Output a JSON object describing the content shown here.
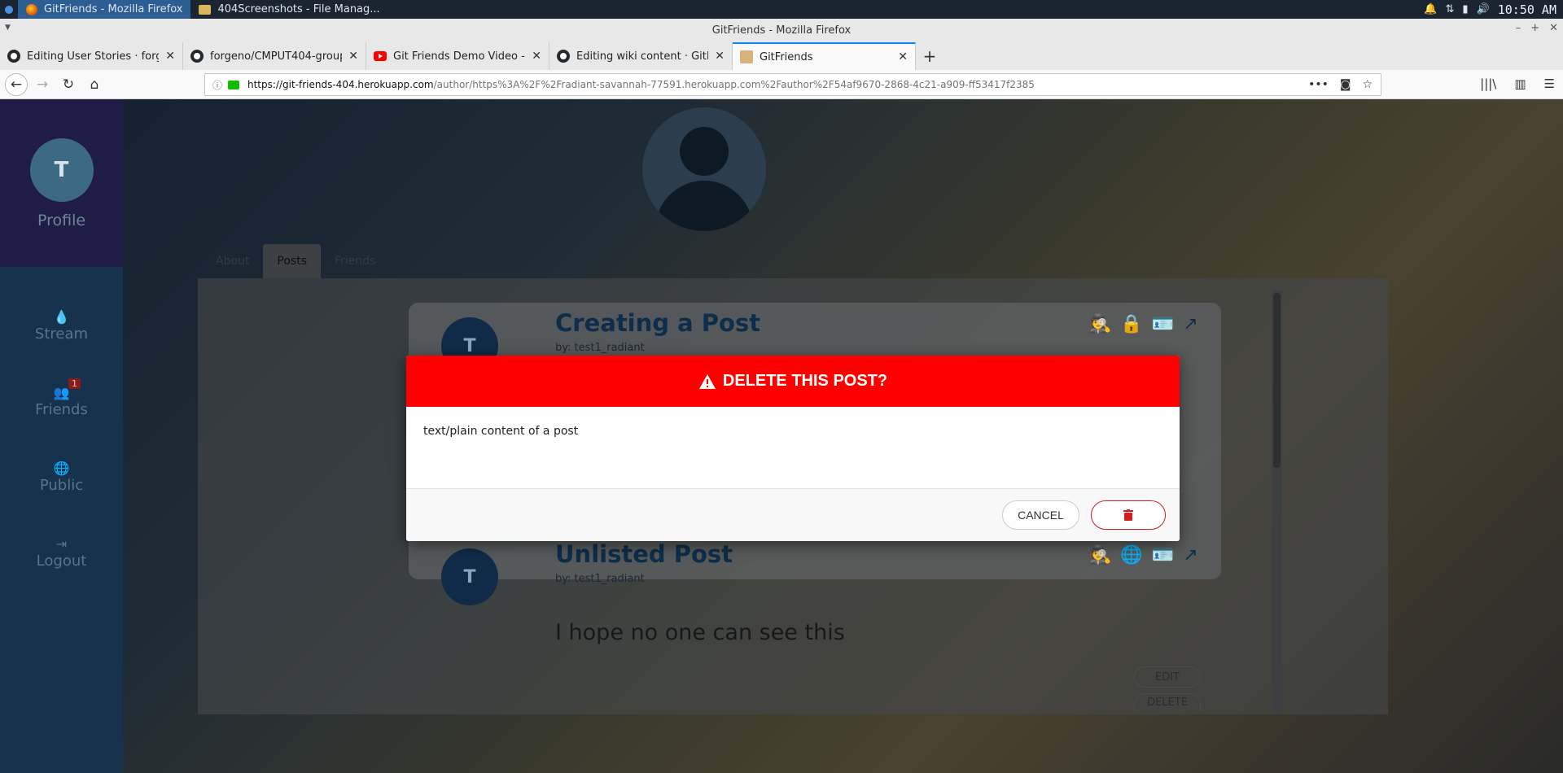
{
  "taskbar": {
    "items": [
      {
        "label": "GitFriends - Mozilla Firefox"
      },
      {
        "label": "404Screenshots - File Manag..."
      }
    ],
    "clock": "10:50 AM"
  },
  "window": {
    "title": "GitFriends - Mozilla Firefox"
  },
  "tabs": [
    {
      "label": "Editing User Stories · forgeno",
      "icon": "github-icon"
    },
    {
      "label": "forgeno/CMPUT404-group-pr",
      "icon": "github-icon"
    },
    {
      "label": "Git Friends Demo Video - You",
      "icon": "youtube-icon"
    },
    {
      "label": "Editing wiki content · GitHub",
      "icon": "github-icon"
    },
    {
      "label": "GitFriends",
      "icon": "gitfriends-icon"
    }
  ],
  "url": {
    "host": "https://git-friends-404.herokuapp.com",
    "path": "/author/https%3A%2F%2Fradiant-savannah-77591.herokuapp.com%2Fauthor%2F54af9670-2868-4c21-a909-ff53417f2385"
  },
  "sidebar": {
    "avatar_initial": "T",
    "profile_label": "Profile",
    "items": [
      {
        "label": "Stream",
        "icon": "droplet-icon"
      },
      {
        "label": "Friends",
        "icon": "users-icon",
        "badge": "1"
      },
      {
        "label": "Public",
        "icon": "globe-icon"
      },
      {
        "label": "Logout",
        "icon": "sign-out-icon"
      }
    ]
  },
  "profile_tabs": [
    {
      "label": "About"
    },
    {
      "label": "Posts"
    },
    {
      "label": "Friends"
    }
  ],
  "posts": [
    {
      "avatar_initial": "T",
      "title": "Creating a Post",
      "by": "by: test1_radiant"
    },
    {
      "avatar_initial": "T",
      "title": "Unlisted Post",
      "by": "by: test1_radiant",
      "body": "I hope no one can see this",
      "edit_label": "EDIT",
      "delete_label": "DELETE"
    }
  ],
  "modal": {
    "title": "DELETE THIS POST?",
    "body": "text/plain content of a post",
    "cancel_label": "CANCEL",
    "accent_color": "#ff0000"
  }
}
